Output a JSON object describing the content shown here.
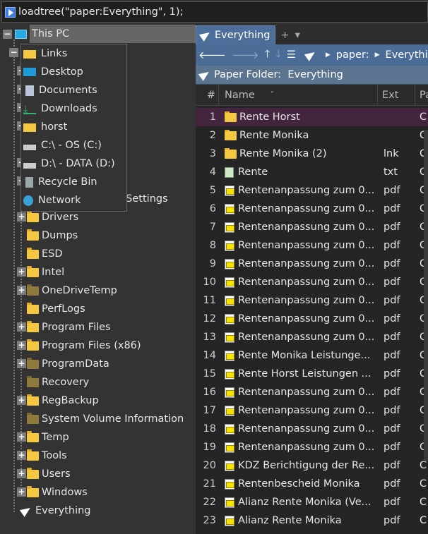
{
  "command": "loadtree(\"paper:Everything\", 1);",
  "tree": {
    "root": "This PC",
    "partial_item": "Documents and Settings",
    "items": [
      {
        "label": "Drivers",
        "exp": true,
        "dim": false
      },
      {
        "label": "Dumps",
        "exp": false,
        "dim": false
      },
      {
        "label": "ESD",
        "exp": false,
        "dim": false
      },
      {
        "label": "Intel",
        "exp": true,
        "dim": false
      },
      {
        "label": "OneDriveTemp",
        "exp": true,
        "dim": true
      },
      {
        "label": "PerfLogs",
        "exp": false,
        "dim": false
      },
      {
        "label": "Program Files",
        "exp": true,
        "dim": false
      },
      {
        "label": "Program Files (x86)",
        "exp": true,
        "dim": false
      },
      {
        "label": "ProgramData",
        "exp": true,
        "dim": true
      },
      {
        "label": "Recovery",
        "exp": false,
        "dim": true
      },
      {
        "label": "RegBackup",
        "exp": true,
        "dim": false
      },
      {
        "label": "System Volume Information",
        "exp": false,
        "dim": true
      },
      {
        "label": "Temp",
        "exp": true,
        "dim": false
      },
      {
        "label": "Tools",
        "exp": true,
        "dim": false
      },
      {
        "label": "Users",
        "exp": true,
        "dim": false
      },
      {
        "label": "Windows",
        "exp": true,
        "dim": false
      }
    ],
    "everything": "Everything"
  },
  "popup": [
    {
      "label": "Links",
      "icon": "folder-icon"
    },
    {
      "label": "Desktop",
      "icon": "desktop-icon"
    },
    {
      "label": "Documents",
      "icon": "documents-icon"
    },
    {
      "label": "Downloads",
      "icon": "download-icon"
    },
    {
      "label": "horst",
      "icon": "folder-icon"
    },
    {
      "label": "C:\\ - OS (C:)",
      "icon": "drive-icon"
    },
    {
      "label": "D:\\ - DATA (D:)",
      "icon": "drive-icon"
    },
    {
      "label": "Recycle Bin",
      "icon": "recycle-bin-icon"
    },
    {
      "label": "Network",
      "icon": "network-icon"
    }
  ],
  "tab": {
    "label": "Everything",
    "add": "+",
    "menu": "▾"
  },
  "nav": {
    "crumbs": [
      "paper:",
      "Everything"
    ]
  },
  "folder_header": "Paper Folder:  Everything",
  "columns": {
    "num": "#",
    "name": "Name",
    "ext": "Ext",
    "path": "Pa"
  },
  "files": [
    {
      "n": "1",
      "name": "Rente Horst",
      "ext": "",
      "type": "folder",
      "path": "C"
    },
    {
      "n": "2",
      "name": "Rente Monika",
      "ext": "",
      "type": "folder",
      "path": "C"
    },
    {
      "n": "3",
      "name": "Rente Monika (2)",
      "ext": "lnk",
      "type": "folder",
      "path": "C"
    },
    {
      "n": "4",
      "name": "Rente",
      "ext": "txt",
      "type": "txt",
      "path": "C"
    },
    {
      "n": "5",
      "name": "Rentenanpassung zum 0...",
      "ext": "pdf",
      "type": "pdf",
      "path": "C"
    },
    {
      "n": "6",
      "name": "Rentenanpassung zum 0...",
      "ext": "pdf",
      "type": "pdf",
      "path": "C"
    },
    {
      "n": "7",
      "name": "Rentenanpassung zum 0...",
      "ext": "pdf",
      "type": "pdf",
      "path": "C"
    },
    {
      "n": "8",
      "name": "Rentenanpassung zum 0...",
      "ext": "pdf",
      "type": "pdf",
      "path": "C"
    },
    {
      "n": "9",
      "name": "Rentenanpassung zum 0...",
      "ext": "pdf",
      "type": "pdf",
      "path": "C"
    },
    {
      "n": "10",
      "name": "Rentenanpassung zum 0...",
      "ext": "pdf",
      "type": "pdf",
      "path": "C"
    },
    {
      "n": "11",
      "name": "Rentenanpassung zum 0...",
      "ext": "pdf",
      "type": "pdf",
      "path": "C"
    },
    {
      "n": "12",
      "name": "Rentenanpassung zum 0...",
      "ext": "pdf",
      "type": "pdf",
      "path": "C"
    },
    {
      "n": "13",
      "name": "Rentenanpassung zum 0...",
      "ext": "pdf",
      "type": "pdf",
      "path": "C"
    },
    {
      "n": "14",
      "name": "Rente Monika Leistunge...",
      "ext": "pdf",
      "type": "pdf",
      "path": "C"
    },
    {
      "n": "15",
      "name": "Rente Horst Leistungen ...",
      "ext": "pdf",
      "type": "pdf",
      "path": "C"
    },
    {
      "n": "16",
      "name": "Rentenanpassung zum 0...",
      "ext": "pdf",
      "type": "pdf",
      "path": "C"
    },
    {
      "n": "17",
      "name": "Rentenanpassung zum 0...",
      "ext": "pdf",
      "type": "pdf",
      "path": "C"
    },
    {
      "n": "18",
      "name": "Rentenanpassung zum 0...",
      "ext": "pdf",
      "type": "pdf",
      "path": "C"
    },
    {
      "n": "19",
      "name": "Rentenanpassung zum 0...",
      "ext": "pdf",
      "type": "pdf",
      "path": "C"
    },
    {
      "n": "20",
      "name": "KDZ Berichtigung der Re...",
      "ext": "pdf",
      "type": "pdf",
      "path": "C"
    },
    {
      "n": "21",
      "name": "Rentenbescheid Monika",
      "ext": "pdf",
      "type": "pdf",
      "path": "C"
    },
    {
      "n": "22",
      "name": "Alianz Rente Monika (Ve...",
      "ext": "pdf",
      "type": "pdf",
      "path": "C"
    },
    {
      "n": "23",
      "name": "Alianz Rente Monika",
      "ext": "pdf",
      "type": "pdf",
      "path": "C"
    }
  ]
}
